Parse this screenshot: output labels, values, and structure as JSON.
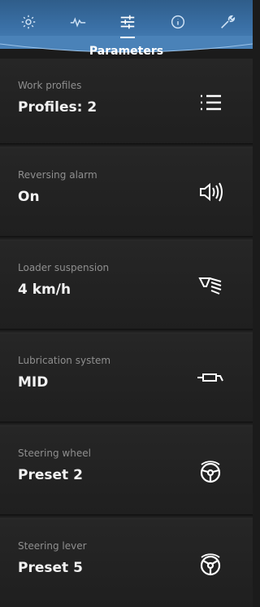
{
  "header": {
    "title": "Parameters",
    "tabs": [
      {
        "name": "settings-gear-icon"
      },
      {
        "name": "activity-wave-icon"
      },
      {
        "name": "sliders-icon",
        "active": true
      },
      {
        "name": "info-icon"
      },
      {
        "name": "wrench-icon"
      }
    ]
  },
  "items": [
    {
      "label": "Work profiles",
      "value": "Profiles: 2",
      "icon": "list-icon"
    },
    {
      "label": "Reversing alarm",
      "value": "On",
      "icon": "speaker-sound-icon"
    },
    {
      "label": "Loader suspension",
      "value": "4 km/h",
      "icon": "suspension-spring-icon"
    },
    {
      "label": "Lubrication system",
      "value": "MID",
      "icon": "grease-gun-icon"
    },
    {
      "label": "Steering wheel",
      "value": "Preset 2",
      "icon": "steering-wheel-icon"
    },
    {
      "label": "Steering lever",
      "value": "Preset 5",
      "icon": "steering-lever-icon"
    }
  ],
  "colors": {
    "header": "#3a70a6",
    "background": "#1b1b1b",
    "label": "#8f8f8f",
    "value": "#f2f2f2"
  }
}
